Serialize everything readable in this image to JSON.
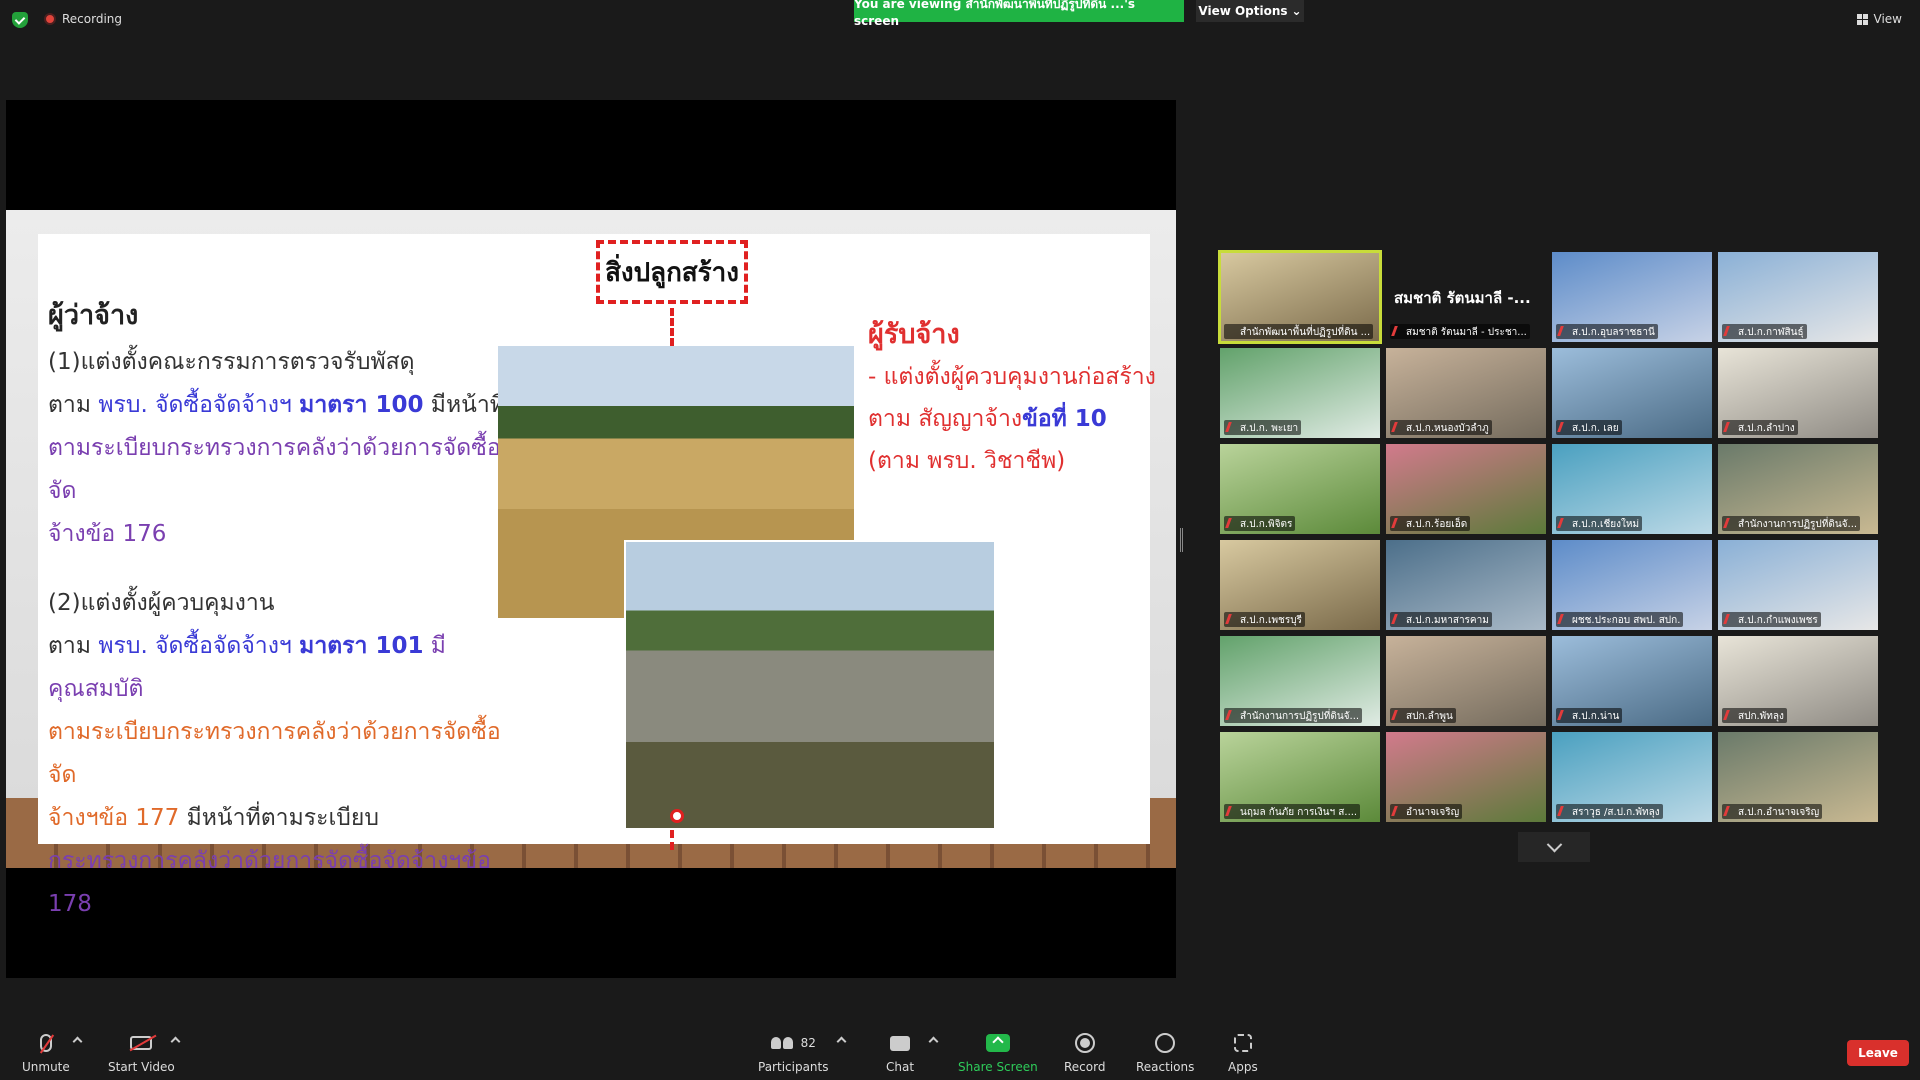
{
  "topbar": {
    "recording_label": "Recording",
    "viewing_banner": "You are viewing สำนักพัฒนาพื้นที่ปฏิรูปที่ดิน ...'s screen",
    "view_options_label": "View Options",
    "view_label": "View"
  },
  "slide": {
    "center_tag": "สิ่งปลูกสร้าง",
    "left": {
      "heading": "ผู้ว่าจ้าง",
      "p1_l1": "(1)แต่งตั้งคณะกรรมการตรวจรับพัสดุ",
      "p1_l2_a": "ตาม ",
      "p1_l2_b": "พรบ. จัดซื้อจัดจ้างฯ ",
      "p1_l2_c": "มาตรา 100",
      "p1_l2_d": " มีหน้าที่",
      "p1_l3": "ตามระเบียบกระทรวงการคลังว่าด้วยการจัดซื้อจัด",
      "p1_l4_a": "จ้าง",
      "p1_l4_b": "ข้อ 176",
      "p2_l1": "(2)แต่งตั้งผู้ควบคุมงาน",
      "p2_l2_a": "ตาม ",
      "p2_l2_b": "พรบ. จัดซื้อจัดจ้างฯ ",
      "p2_l2_c": "มาตรา 101",
      "p2_l2_d": " มีคุณสมบัติ",
      "p2_l3": "ตามระเบียบกระทรวงการคลังว่าด้วยการจัดซื้อจัด",
      "p2_l4_a": "จ้างฯข้อ 177",
      "p2_l4_b": " มีหน้าที่ตามระเบียบ",
      "p2_l5_a": "กระทรวงการคลังว่าด้วยการจัดซื้อจัดจ้างฯ",
      "p2_l5_b": "ข้อ 178"
    },
    "right": {
      "heading": "ผู้รับจ้าง",
      "l1": " - แต่งตั้งผู้ควบคุมงานก่อสร้าง",
      "l2_a": "ตาม สัญญาจ้าง",
      "l2_b": "ข้อที่ 10",
      "l3": "(ตาม พรบ. วิชาชีพ)"
    }
  },
  "gallery": {
    "tiles": [
      {
        "name": "สำนักพัฒนาพื้นที่ปฏิรูปที่ดิน ...",
        "muted": false
      },
      {
        "name": "สมชาติ รัตนมาลี - ประชา...",
        "muted": true,
        "big": "สมชาติ รัตนมาลี -..."
      },
      {
        "name": "ส.ป.ก.อุบลราชธานี",
        "muted": true
      },
      {
        "name": "ส.ป.ก.กาฬสินธุ์",
        "muted": true
      },
      {
        "name": "ส.ป.ก. พะเยา",
        "muted": true
      },
      {
        "name": "ส.ป.ก.หนองบัวลำภู",
        "muted": true
      },
      {
        "name": "ส.ป.ก. เลย",
        "muted": true
      },
      {
        "name": "ส.ป.ก.ลำปาง",
        "muted": true
      },
      {
        "name": "ส.ป.ก.พิจิตร",
        "muted": true
      },
      {
        "name": "ส.ป.ก.ร้อยเอ็ด",
        "muted": true
      },
      {
        "name": "ส.ป.ก.เชียงใหม่",
        "muted": true
      },
      {
        "name": "สำนักงานการปฏิรูปที่ดินจั...",
        "muted": true
      },
      {
        "name": "ส.ป.ก.เพชรบุรี",
        "muted": true
      },
      {
        "name": "ส.ป.ก.มหาสารคาม",
        "muted": true
      },
      {
        "name": "ผชช.ประกอบ สพป. สปก.",
        "muted": true
      },
      {
        "name": "ส.ป.ก.กำแพงเพชร",
        "muted": true
      },
      {
        "name": "สำนักงานการปฏิรูปที่ดินจั...",
        "muted": true
      },
      {
        "name": "สปก.ลำพูน",
        "muted": true
      },
      {
        "name": "ส.ป.ก.น่าน",
        "muted": true
      },
      {
        "name": "สปก.พัทลุง",
        "muted": true
      },
      {
        "name": "นฤมล กันภัย การเงินฯ ส....",
        "muted": true
      },
      {
        "name": "อำนาจเจริญ",
        "muted": true
      },
      {
        "name": "สราวุธ /ส.ป.ก.พัทลุง",
        "muted": true
      },
      {
        "name": "ส.ป.ก.อำนาจเจริญ",
        "muted": true
      }
    ]
  },
  "toolbar": {
    "unmute": "Unmute",
    "start_video": "Start Video",
    "participants": "Participants",
    "participants_count": "82",
    "chat": "Chat",
    "share_screen": "Share Screen",
    "record": "Record",
    "reactions": "Reactions",
    "apps": "Apps",
    "leave": "Leave"
  },
  "colors": {
    "accent_green": "#1fb344",
    "leave_red": "#d9302c",
    "active_speaker": "#c8dc3a"
  }
}
